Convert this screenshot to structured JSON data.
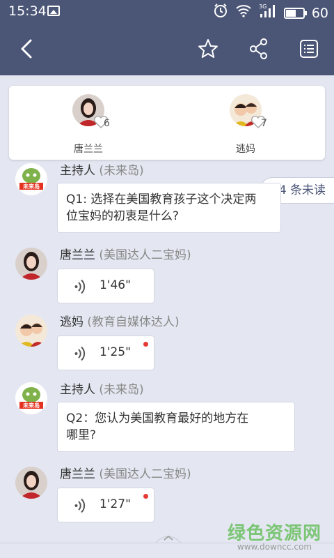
{
  "status_bar": {
    "time": "15:34",
    "network": "3G",
    "battery": "60"
  },
  "app_bar": {
    "back_icon": "back-arrow-icon",
    "star_icon": "star-icon",
    "share_icon": "share-icon",
    "list_icon": "list-icon"
  },
  "participants": [
    {
      "name": "唐兰兰",
      "count": "6",
      "avatar": "avatar-tanglanlan"
    },
    {
      "name": "逃妈",
      "count": "7",
      "avatar": "avatar-taoma"
    }
  ],
  "unread_badge": "14 条未读",
  "messages": [
    {
      "sender": "主持人",
      "tag": "(未来岛)",
      "type": "text",
      "text_line1": "Q1: 选择在美国教育孩子这个决定两",
      "text_line2": "位宝妈的初衷是什么?"
    },
    {
      "sender": "唐兰兰",
      "tag": "(美国达人二宝妈)",
      "type": "voice",
      "duration": "1'46\"",
      "unheard": false
    },
    {
      "sender": "逃妈",
      "tag": "(教育自媒体达人)",
      "type": "voice",
      "duration": "1'25\"",
      "unheard": true
    },
    {
      "sender": "主持人",
      "tag": "(未来岛)",
      "type": "text",
      "text_line1": "Q2：您认为美国教育最好的地方在",
      "text_line2": "哪里?"
    },
    {
      "sender": "唐兰兰",
      "tag": "(美国达人二宝妈)",
      "type": "voice",
      "duration": "1'27\"",
      "unheard": true
    }
  ],
  "watermark": {
    "cn": "绿色资源网",
    "url": "www.downcc.com"
  },
  "colors": {
    "header": "#4b5677",
    "background": "#e4e7f1",
    "unread_dot": "#e53935",
    "watermark": "#7cc576"
  }
}
